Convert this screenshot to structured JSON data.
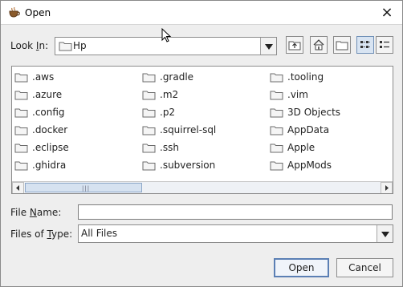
{
  "dialog": {
    "title": "Open",
    "close_glyph": "×"
  },
  "look_in": {
    "label_pre": "Look ",
    "label_accel": "I",
    "label_post": "n:",
    "value": "Hp"
  },
  "toolbar": {
    "buttons": [
      "up-one-level-icon",
      "home-icon",
      "new-folder-icon",
      "list-view-icon",
      "details-view-icon"
    ],
    "active": "list-view-icon"
  },
  "files": {
    "columns": [
      [
        ".aws",
        ".azure",
        ".config",
        ".docker",
        ".eclipse",
        ".ghidra"
      ],
      [
        ".gradle",
        ".m2",
        ".p2",
        ".squirrel-sql",
        ".ssh",
        ".subversion"
      ],
      [
        ".tooling",
        ".vim",
        "3D Objects",
        "AppData",
        "Apple",
        "AppMods"
      ]
    ],
    "scroll_grip": "|||"
  },
  "file_name": {
    "label_pre": "File ",
    "label_accel": "N",
    "label_post": "ame:",
    "value": ""
  },
  "file_type": {
    "label_pre": "Files of ",
    "label_accel": "T",
    "label_post": "ype:",
    "value": "All Files"
  },
  "buttons": {
    "open": "Open",
    "cancel": "Cancel"
  },
  "colors": {
    "folder": "#f5f5f5",
    "folder_stroke": "#6b6b6b",
    "accent": "#5b7fb4"
  }
}
